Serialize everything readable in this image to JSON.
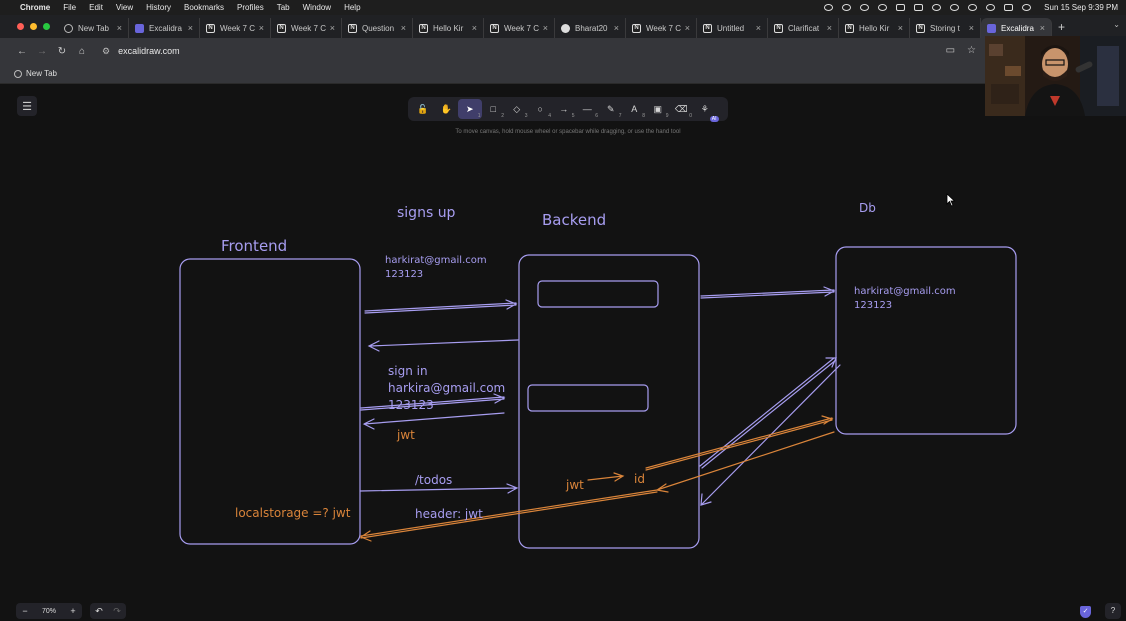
{
  "menubar": {
    "app": "Chrome",
    "items": [
      "File",
      "Edit",
      "View",
      "History",
      "Bookmarks",
      "Profiles",
      "Tab",
      "Window",
      "Help"
    ],
    "clock": "Sun 15 Sep  9:39 PM"
  },
  "tabs": [
    {
      "label": "New Tab",
      "icon": "chrome-icon"
    },
    {
      "label": "Excalidra",
      "icon": "excalidraw-icon"
    },
    {
      "label": "Week 7 C",
      "icon": "notion-icon"
    },
    {
      "label": "Week 7 C",
      "icon": "notion-icon"
    },
    {
      "label": "Question",
      "icon": "notion-icon"
    },
    {
      "label": "Hello Kir",
      "icon": "notion-icon"
    },
    {
      "label": "Week 7 C",
      "icon": "notion-icon"
    },
    {
      "label": "Bharat20",
      "icon": "github-icon"
    },
    {
      "label": "Week 7 C",
      "icon": "notion-icon"
    },
    {
      "label": "Untitled",
      "icon": "notion-icon"
    },
    {
      "label": "Clarificat",
      "icon": "notion-icon"
    },
    {
      "label": "Hello Kir",
      "icon": "notion-icon"
    },
    {
      "label": "Storing t",
      "icon": "notion-icon"
    },
    {
      "label": "Excalidra",
      "icon": "excalidraw-icon",
      "active": true
    }
  ],
  "address": {
    "url": "excalidraw.com"
  },
  "bookmarks": [
    {
      "label": "New Tab"
    }
  ],
  "toolbar": {
    "tools": [
      {
        "name": "lock",
        "glyph": "🔓",
        "num": ""
      },
      {
        "name": "hand",
        "glyph": "✋",
        "num": ""
      },
      {
        "name": "selection",
        "glyph": "➤",
        "num": "1",
        "active": true
      },
      {
        "name": "rectangle",
        "glyph": "□",
        "num": "2"
      },
      {
        "name": "diamond",
        "glyph": "◇",
        "num": "3"
      },
      {
        "name": "ellipse",
        "glyph": "○",
        "num": "4"
      },
      {
        "name": "arrow",
        "glyph": "→",
        "num": "5"
      },
      {
        "name": "line",
        "glyph": "—",
        "num": "6"
      },
      {
        "name": "draw",
        "glyph": "✎",
        "num": "7"
      },
      {
        "name": "text",
        "glyph": "A",
        "num": "8"
      },
      {
        "name": "image",
        "glyph": "▣",
        "num": "9"
      },
      {
        "name": "eraser",
        "glyph": "⌫",
        "num": "0"
      },
      {
        "name": "library",
        "glyph": "⚘",
        "num": "",
        "badge": "AI"
      }
    ],
    "hint": "To move canvas, hold mouse wheel or spacebar while dragging, or use the hand tool"
  },
  "zoom": {
    "value": "70%",
    "minus": "−",
    "plus": "+"
  },
  "drawing": {
    "frontend_label": "Frontend",
    "backend_label": "Backend",
    "db_label": "Db",
    "signs_up": "signs up",
    "signup_email": "harkirat@gmail.com",
    "signup_password": "123123",
    "db_email": "harkirat@gmail.com",
    "db_password": "123123",
    "sign_in": "sign in",
    "signin_email": "harkira@gmail.com",
    "signin_password": "123123",
    "jwt_response": "jwt",
    "todos": "/todos",
    "header_jwt": "header:  jwt",
    "localstorage": "localstorage =? jwt",
    "backend_jwt": "jwt",
    "backend_id": "id"
  },
  "colors": {
    "purple": "#a79df0",
    "orange": "#d9843a",
    "canvas": "#121212"
  }
}
